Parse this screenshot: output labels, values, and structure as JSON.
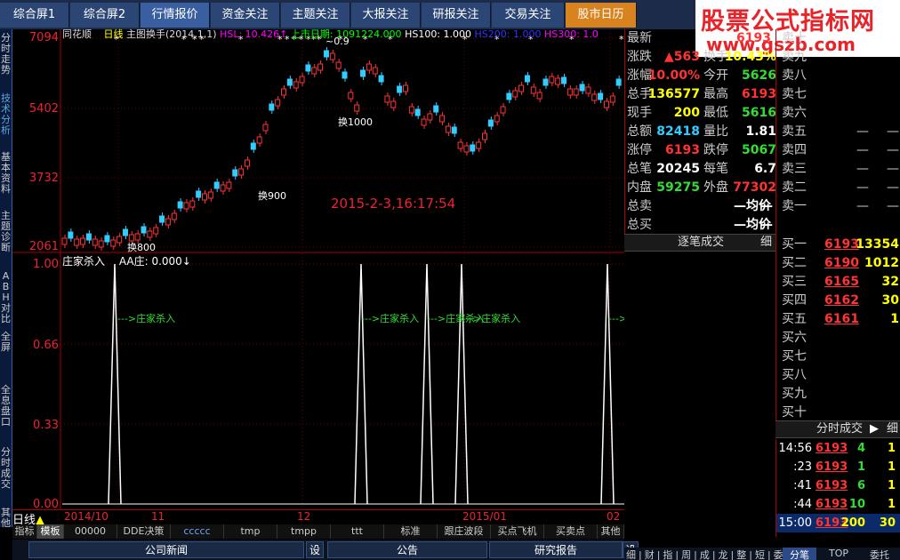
{
  "tabs": [
    "综合屏1",
    "综合屏2",
    "行情报价",
    "资金关注",
    "主题关注",
    "大报关注",
    "研报关注",
    "交易关注",
    "股市日历"
  ],
  "watermark": {
    "line1": "股票公式指标网",
    "line2": "www.gszb.com"
  },
  "left_sidebar": [
    "分时走势",
    "技术分析",
    "基本资料",
    "主题诊断",
    "ABH对比",
    "全屏",
    "全息盘口",
    "分时成交",
    "其他"
  ],
  "chart_header": {
    "stock": "同花顺",
    "period": "日线",
    "main": "主图换手",
    "params": "(2014,1,1)",
    "hsl": "HSL: 10.426↑",
    "listing": "上市日期: 1091224.000",
    "hs100": "HS100: 1.000",
    "hs200": "HS200: 1.000",
    "hs300": "HS300: 1.0"
  },
  "price_labels": [
    "7094",
    "5402",
    "3732",
    "2061"
  ],
  "annotations": {
    "a1": "换1000",
    "a2": "换900",
    "a3": "换800",
    "a4": "~0.9",
    "timestamp": "2015-2-3,16:17:54"
  },
  "sub_header": {
    "name": "庄家杀入",
    "value": "AA庄: 0.000↓"
  },
  "sub_labels": [
    "1.00",
    "0.66",
    "0.33",
    "0.00"
  ],
  "signal_text": "--->庄家杀入",
  "date_labels": [
    "日线",
    "2014/10",
    "11",
    "12",
    "2015/01",
    "02"
  ],
  "bottom_tabs": [
    "指标",
    "模板",
    "00000",
    "DDE决策",
    "ccccc",
    "tmp",
    "tmpp",
    "ttt",
    "标准",
    "跟庄波段",
    "买点飞机",
    "买卖点",
    "其他"
  ],
  "bottom_tabs2": [
    "公司新闻",
    "设",
    "公告",
    "研究报告",
    "设"
  ],
  "quote": [
    {
      "l": "最新",
      "v": "6193",
      "c": "rd"
    },
    {
      "l": "涨跌",
      "v": "▲563",
      "c": "rd",
      "l2": "换手",
      "v2": "10.43%",
      "c2": "yw"
    },
    {
      "l": "涨幅",
      "v": "10.00%",
      "c": "rd",
      "l2": "今开",
      "v2": "5626",
      "c2": "gr"
    },
    {
      "l": "总手",
      "v": "136577",
      "c": "yw",
      "l2": "最高",
      "v2": "6193",
      "c2": "rd"
    },
    {
      "l": "现手",
      "v": "200",
      "c": "yw",
      "l2": "最低",
      "v2": "5616",
      "c2": "gr"
    },
    {
      "l": "总额",
      "v": "82418",
      "c": "cy",
      "l2": "量比",
      "v2": "1.81",
      "c2": "wt"
    },
    {
      "l": "涨停",
      "v": "6193",
      "c": "rd",
      "l2": "跌停",
      "v2": "5067",
      "c2": "gr"
    },
    {
      "l": "总笔",
      "v": "20245",
      "c": "wt",
      "l2": "每笔",
      "v2": "6.7",
      "c2": "wt"
    },
    {
      "l": "内盘",
      "v": "59275",
      "c": "gr",
      "l2": "外盘",
      "v2": "77302",
      "c2": "rd"
    },
    {
      "l": "总卖",
      "v": "—均价",
      "c": "wt",
      "v3": "—"
    },
    {
      "l": "总买",
      "v": "—均价",
      "c": "wt",
      "v3": "—"
    }
  ],
  "trades_header": {
    "label": "逐笔成交",
    "btn": "细"
  },
  "asks": [
    {
      "l": "卖十"
    },
    {
      "l": "卖九"
    },
    {
      "l": "卖八"
    },
    {
      "l": "卖七"
    },
    {
      "l": "卖六"
    },
    {
      "l": "卖五",
      "d": "—",
      "e": "—"
    },
    {
      "l": "卖四",
      "d": "—",
      "e": "—"
    },
    {
      "l": "卖三",
      "d": "—",
      "e": "—"
    },
    {
      "l": "卖二",
      "d": "—",
      "e": "—"
    },
    {
      "l": "卖一",
      "d": "—",
      "e": "—"
    }
  ],
  "bids": [
    {
      "l": "买一",
      "p": "6193",
      "v": "13354"
    },
    {
      "l": "买二",
      "p": "6190",
      "v": "1012"
    },
    {
      "l": "买三",
      "p": "6165",
      "v": "32"
    },
    {
      "l": "买四",
      "p": "6162",
      "v": "30"
    },
    {
      "l": "买五",
      "p": "6161",
      "v": "1"
    },
    {
      "l": "买六"
    },
    {
      "l": "买七"
    },
    {
      "l": "买八"
    },
    {
      "l": "买九"
    },
    {
      "l": "买十"
    }
  ],
  "ticks_header": {
    "label": "分时成交",
    "btn": "细"
  },
  "ticks": [
    {
      "t": "14:56",
      "p": "6193",
      "v": "4",
      "n": "1"
    },
    {
      "t": ":23",
      "p": "6193",
      "v": "1",
      "n": "1"
    },
    {
      "t": ":41",
      "p": "6193",
      "v": "6",
      "n": "1"
    },
    {
      "t": ":44",
      "p": "6193",
      "v": "10",
      "n": "1"
    },
    {
      "t": "15:00",
      "p": "6193",
      "v": "200",
      "n": "30"
    }
  ],
  "right_bottom": {
    "tabs": "细|财|指|周|成|龙|整|短|委",
    "tab1": "分笔",
    "tab2": "TOP",
    "tab3": "委托"
  }
}
